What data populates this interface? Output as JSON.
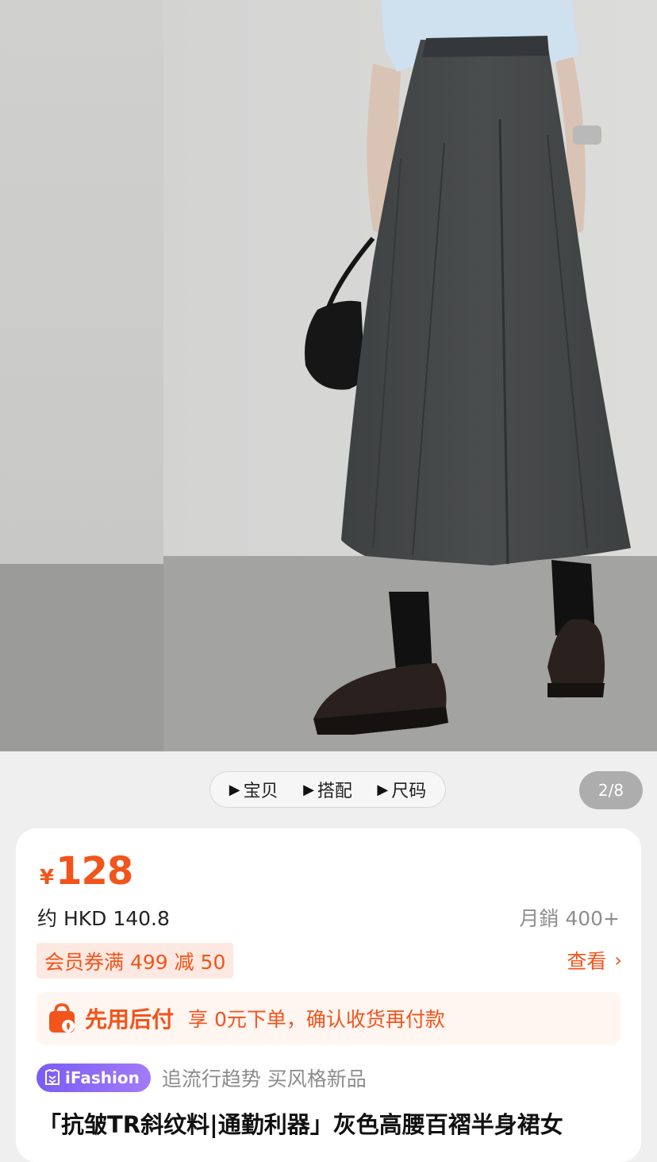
{
  "media_tabs": [
    {
      "label": "宝贝"
    },
    {
      "label": "搭配"
    },
    {
      "label": "尺码"
    }
  ],
  "page_counter": "2/8",
  "price": {
    "symbol": "¥",
    "value": "128"
  },
  "hkd_price": "约 HKD 140.8",
  "monthly_sales": "月銷 400+",
  "coupon": "会员券满 499 减 50",
  "view_link": "查看",
  "pay_later": {
    "title": "先用后付",
    "description": "享 0元下单，确认收货再付款"
  },
  "brand_badge": "iFashion",
  "tagline": "追流行趋势 买风格新品",
  "product_title": "「抗皱TR斜纹料|通勤利器」灰色高腰百褶半身裙女",
  "colors": {
    "accent": "#f2541b",
    "badge_purple": "#7a5cf5",
    "page_bg": "#efefef"
  }
}
